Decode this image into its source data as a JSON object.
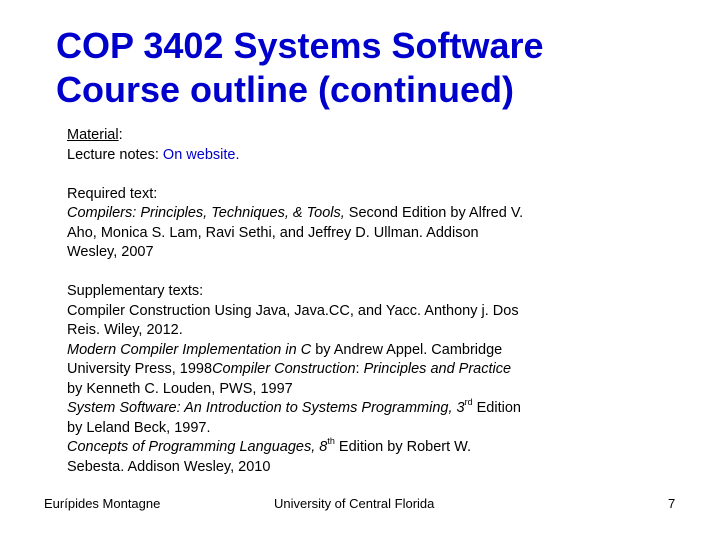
{
  "title": {
    "line1": "COP 3402 Systems Software",
    "line2": "Course outline (continued)"
  },
  "material": {
    "heading": "Material",
    "colon": ":",
    "lecture_label": "Lecture notes: ",
    "lecture_value": "On website."
  },
  "required": {
    "heading": "Required text:",
    "book_title": "Compilers: Principles, Techniques, & Tools,",
    "line1_rest": " Second Edition by Alfred V.",
    "line2": "Aho, Monica S. Lam, Ravi Sethi, and Jeffrey D. Ullman. Addison",
    "line3": "Wesley, 2007"
  },
  "supplementary": {
    "heading": "Supplementary texts:",
    "l1": "Compiler Construction Using Java, Java.CC, and Yacc. Anthony j. Dos",
    "l2": "Reis. Wiley, 2012.",
    "l3_title": "Modern Compiler Implementation in C",
    "l3_rest": "  by Andrew Appel. Cambridge",
    "l4_a": "University Press, 1998",
    "l4_title_a": "Compiler Construction",
    "l4_colon": ":",
    "l4_title_b": " Principles and Practice",
    "l5": "by Kenneth C. Louden, PWS, 1997",
    "l6_title": "System Software: An Introduction to Systems Programming, 3",
    "l6_sup": "rd",
    "l6_rest": "  Edition",
    "l7": "by Leland Beck, 1997.",
    "l8_title": "Concepts of Programming Languages, 8",
    "l8_sup": "th",
    "l8_rest": " Edition by Robert W.",
    "l9": "Sebesta.  Addison Wesley, 2010"
  },
  "footer": {
    "author": "Eurípides Montagne",
    "institution": "University of Central Florida",
    "page_number": "7"
  }
}
